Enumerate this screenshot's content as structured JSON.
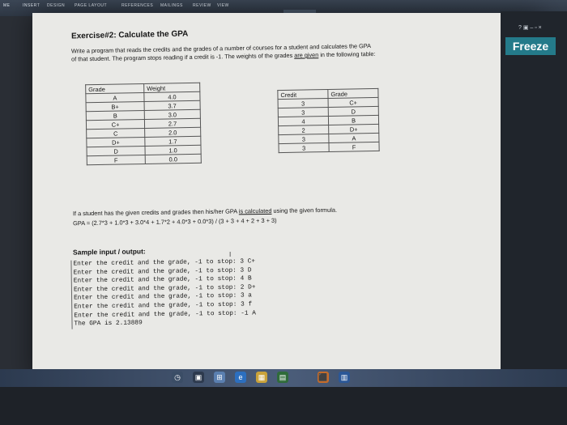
{
  "ribbon": {
    "tabs": [
      "ME",
      "INSERT",
      "DESIGN",
      "PAGE LAYOUT",
      "REFERENCES",
      "MAILINGS",
      "REVIEW",
      "VIEW"
    ]
  },
  "side": {
    "freeze_label": "Freeze",
    "dots": "? ▣ – ▫ ×"
  },
  "doc": {
    "title": "Exercise#2: Calculate the GPA",
    "desc1": "Write a program that reads the credits and the grades of a number of courses for a student and calculates the GPA",
    "desc2a": "of that student. The program stops reading if a credit is -1. The weights of the grades ",
    "desc2b": "are given",
    "desc2c": " in the following table:",
    "weights_table": {
      "headers": [
        "Grade",
        "Weight"
      ],
      "rows": [
        [
          "A",
          "4.0"
        ],
        [
          "B+",
          "3.7"
        ],
        [
          "B",
          "3.0"
        ],
        [
          "C+",
          "2.7"
        ],
        [
          "C",
          "2.0"
        ],
        [
          "D+",
          "1.7"
        ],
        [
          "D",
          "1.0"
        ],
        [
          "F",
          "0.0"
        ]
      ]
    },
    "credits_table": {
      "headers": [
        "Credit",
        "Grade"
      ],
      "rows": [
        [
          "3",
          "C+"
        ],
        [
          "3",
          "D"
        ],
        [
          "4",
          "B"
        ],
        [
          "2",
          "D+"
        ],
        [
          "3",
          "A"
        ],
        [
          "3",
          "F"
        ]
      ]
    },
    "formula_1a": "If a student has the given credits and grades then his/her GPA ",
    "formula_1b": "is calculated",
    "formula_1c": " using the given formula.",
    "formula_2": "GPA = (2.7*3 + 1.0*3 + 3.0*4 + 1.7*2 + 4.0*3 + 0.0*3) / (3 + 3 + 4 + 2 + 3 + 3)",
    "sample_heading": "Sample input / output:",
    "cursor": "I",
    "console_lines": [
      "Enter the credit and the grade, -1 to stop: 3 C+",
      "Enter the credit and the grade, -1 to stop: 3 D",
      "Enter the credit and the grade, -1 to stop: 4 B",
      "Enter the credit and the grade, -1 to stop: 2 D+",
      "Enter the credit and the grade, -1 to stop: 3 a",
      "Enter the credit and the grade, -1 to stop: 3 f",
      "Enter the credit and the grade, -1 to stop: -1 A",
      "The GPA is 2.13889"
    ]
  },
  "taskbar": {
    "icons": [
      "◷",
      "▣",
      "⊞",
      "e",
      "▦",
      "▤",
      "⬛",
      "▥"
    ]
  }
}
